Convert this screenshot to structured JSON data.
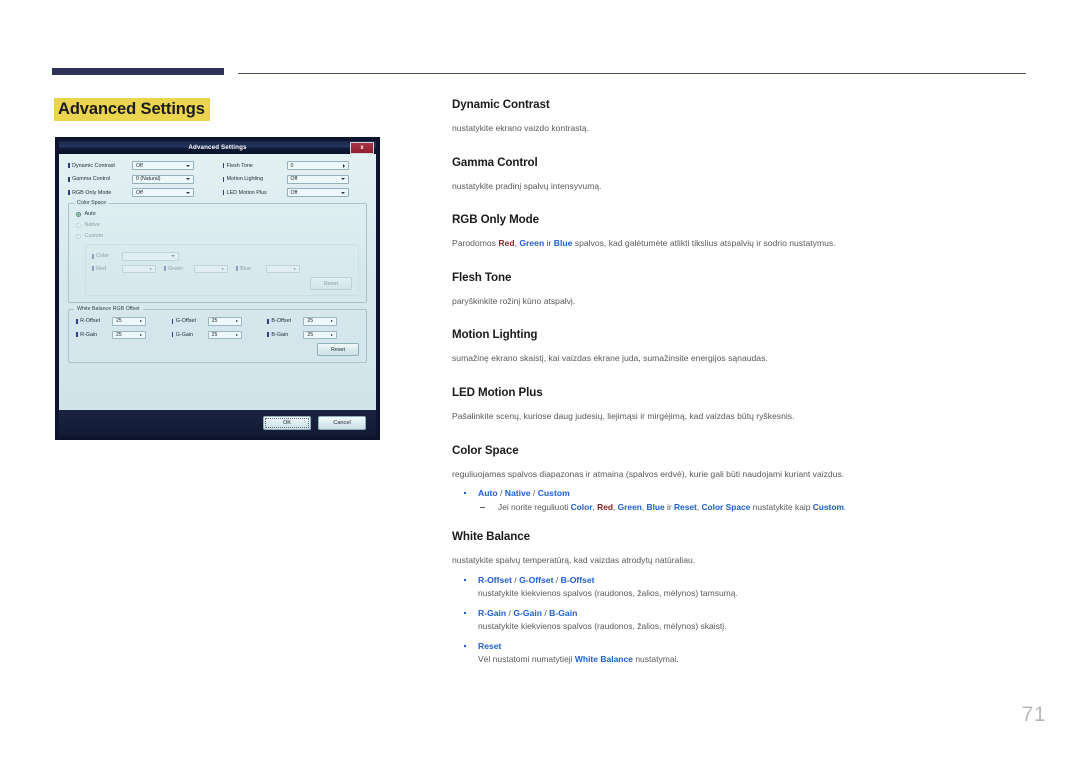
{
  "page": {
    "title": "Advanced Settings",
    "number": "71",
    "accent_navy": "#2f3358",
    "highlight_yellow": "#ecd54e",
    "link_blue": "#1d5fd0",
    "red_term": "#8d2128"
  },
  "dialog": {
    "title": "Advanced Settings",
    "close_label": "x",
    "fields": [
      {
        "label": "Dynamic Contrast",
        "value": "Off",
        "kind": "dropdown"
      },
      {
        "label": "Flesh Tone",
        "value": "0",
        "kind": "spinner"
      },
      {
        "label": "Gamma Control",
        "value": "0 (Natural)",
        "kind": "dropdown"
      },
      {
        "label": "Motion Lighting",
        "value": "Off",
        "kind": "dropdown"
      },
      {
        "label": "RGB Only Mode",
        "value": "Off",
        "kind": "dropdown"
      },
      {
        "label": "LED Motion Plus",
        "value": "Off",
        "kind": "dropdown"
      }
    ],
    "color_space": {
      "group_title": "Color Space",
      "options": [
        {
          "label": "Auto",
          "selected": true
        },
        {
          "label": "Native",
          "selected": false
        },
        {
          "label": "Custom",
          "selected": false
        }
      ],
      "custom": {
        "color_label": "Color",
        "color_value": "",
        "channels": [
          {
            "label": "Red",
            "value": ""
          },
          {
            "label": "Green",
            "value": ""
          },
          {
            "label": "Blue",
            "value": ""
          }
        ],
        "reset_label": "Reset"
      }
    },
    "white_balance": {
      "group_title": "White Balance RGB Offset",
      "rows": [
        {
          "label": "R-Offset",
          "value": "25"
        },
        {
          "label": "G-Offset",
          "value": "25"
        },
        {
          "label": "B-Offset",
          "value": "25"
        },
        {
          "label": "R-Gain",
          "value": "25"
        },
        {
          "label": "G-Gain",
          "value": "25"
        },
        {
          "label": "B-Gain",
          "value": "25"
        }
      ],
      "reset_label": "Reset"
    },
    "footer": {
      "ok_label": "OK",
      "cancel_label": "Cancel"
    }
  },
  "sections": {
    "dynamic_contrast": {
      "title": "Dynamic Contrast",
      "body": "nustatykite ekrano vaizdo kontrastą."
    },
    "gamma_control": {
      "title": "Gamma Control",
      "body": "nustatykite pradinį spalvų intensyvumą."
    },
    "rgb_only_mode": {
      "title": "RGB Only Mode",
      "body_pre": "Parodomos ",
      "term_red": "Red",
      "body_mid1": ", ",
      "term_green": "Green",
      "body_mid2": " ir ",
      "term_blue": "Blue",
      "body_post": " spalvos, kad galėtumėte atlikti tikslius atspalvių ir sodrio nustatymus."
    },
    "flesh_tone": {
      "title": "Flesh Tone",
      "body": "paryškinkite rožinį kūno atspalvį."
    },
    "motion_lighting": {
      "title": "Motion Lighting",
      "body": "sumažinę ekrano skaistį, kai vaizdas ekrane juda, sumažinsite energijos sąnaudas."
    },
    "led_motion_plus": {
      "title": "LED Motion Plus",
      "body": "Pašalinkite scenų, kuriose daug judesių, liejimąsi ir mirgėjimą, kad vaizdas būtų ryškesnis."
    },
    "color_space": {
      "title": "Color Space",
      "body": "reguliuojamas spalvos diapazonas ir atmaina (spalvos erdvė), kurie gali būti naudojami kuriant vaizdus.",
      "bullet_auto": "Auto",
      "bullet_native": "Native",
      "bullet_custom": "Custom",
      "sub_pre": "Jei norite reguliuoti ",
      "sub_color": "Color",
      "sub_red": "Red",
      "sub_green": "Green",
      "sub_blue": "Blue",
      "sub_ir": " ir ",
      "sub_reset": "Reset",
      "sub_colorspace": "Color Space",
      "sub_mid": " nustatykite kaip ",
      "sub_custom": "Custom",
      "sub_end": "."
    },
    "white_balance": {
      "title": "White Balance",
      "body": "nustatykite spalvų temperatūrą, kad vaizdas atrodytų natūraliau.",
      "b1_r": "R-Offset",
      "b1_g": "G-Offset",
      "b1_b": "B-Offset",
      "b1_desc": "nustatykite kiekvienos spalvos (raudonos, žalios, mėlynos) tamsumą.",
      "b2_r": "R-Gain",
      "b2_g": "G-Gain",
      "b2_b": "B-Gain",
      "b2_desc": "nustatykite kiekvienos spalvos (raudonos, žalios, mėlynos) skaistį.",
      "b3_reset": "Reset",
      "b3_pre": "Vėl nustatomi numatytieji ",
      "b3_term": "White Balance",
      "b3_post": " nustatymai."
    }
  }
}
